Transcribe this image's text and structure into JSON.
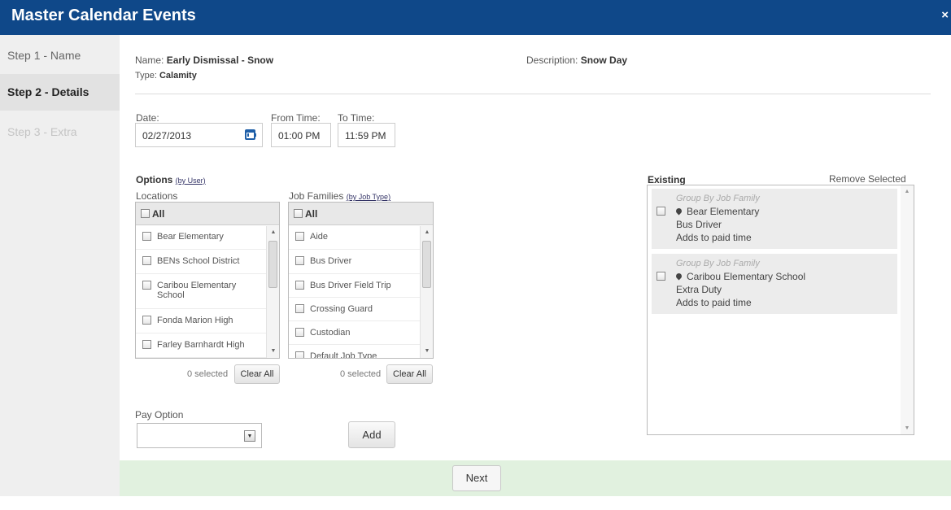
{
  "header": {
    "title": "Master Calendar Events",
    "close_glyph": "×"
  },
  "steps": [
    {
      "label": "Step 1 - Name"
    },
    {
      "label": "Step 2 - Details"
    },
    {
      "label": "Step 3 - Extra"
    }
  ],
  "summary": {
    "name_label": "Name:",
    "name_value": "Early Dismissal - Snow",
    "type_label": "Type:",
    "type_value": "Calamity",
    "description_label": "Description:",
    "description_value": "Snow Day"
  },
  "date": {
    "label": "Date:",
    "value": "02/27/2013",
    "icon": "calendar-icon"
  },
  "from_time": {
    "label": "From Time:",
    "value": "01:00 PM"
  },
  "to_time": {
    "label": "To Time:",
    "value": "11:59 PM"
  },
  "options": {
    "title": "Options",
    "by_user_link": "(by User)",
    "locations": {
      "label": "Locations",
      "all_label": "All",
      "items": [
        "Bear Elementary",
        "BENs School District",
        "Caribou Elementary School",
        "Fonda Marion High",
        "Farley Barnhardt High"
      ],
      "selected_text": "0 selected",
      "clear_label": "Clear All"
    },
    "job_families": {
      "label": "Job Families",
      "by_job_type_link": "(by Job Type)",
      "all_label": "All",
      "items": [
        "Aide",
        "Bus Driver",
        "Bus Driver Field Trip",
        "Crossing Guard",
        "Custodian",
        "Default Job Type"
      ],
      "selected_text": "0 selected",
      "clear_label": "Clear All"
    }
  },
  "pay_option": {
    "label": "Pay Option",
    "value": ""
  },
  "add_button": "Add",
  "existing": {
    "title": "Existing",
    "remove_label": "Remove Selected",
    "items": [
      {
        "group": "Group By Job Family",
        "location": "Bear Elementary",
        "job": "Bus Driver",
        "note": "Adds to paid time"
      },
      {
        "group": "Group By Job Family",
        "location": "Caribou Elementary School",
        "job": "Extra Duty",
        "note": "Adds to paid time"
      }
    ]
  },
  "next_button": "Next"
}
